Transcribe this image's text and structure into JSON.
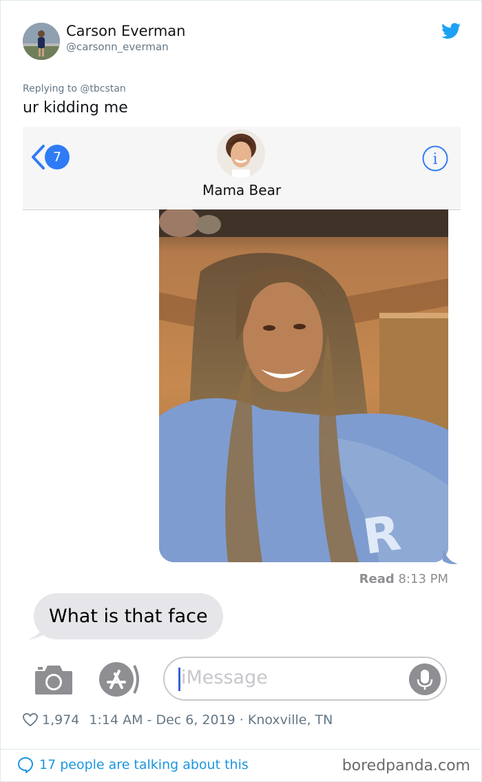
{
  "tweet": {
    "author_name": "Carson Everman",
    "author_handle": "@carsonn_everman",
    "replying_prefix": "Replying to",
    "replying_handle": "@tbcstan",
    "text": "ur kidding me",
    "likes": "1,974",
    "timestamp": "1:14 AM - Dec 6, 2019",
    "location": "Knoxville, TN",
    "talking": "17 people are talking about this",
    "brand_color": "#1da1f2"
  },
  "imessage": {
    "back_count": "7",
    "contact_name": "Mama Bear",
    "read_label": "Read",
    "read_time": "8:13 PM",
    "incoming_message": "What is that face",
    "input_placeholder": "iMessage",
    "accent_color": "#2f7bf5",
    "icons": [
      "chevron-left-icon",
      "info-icon",
      "camera-icon",
      "app-store-icon",
      "microphone-icon"
    ]
  },
  "watermark": "boredpanda.com"
}
